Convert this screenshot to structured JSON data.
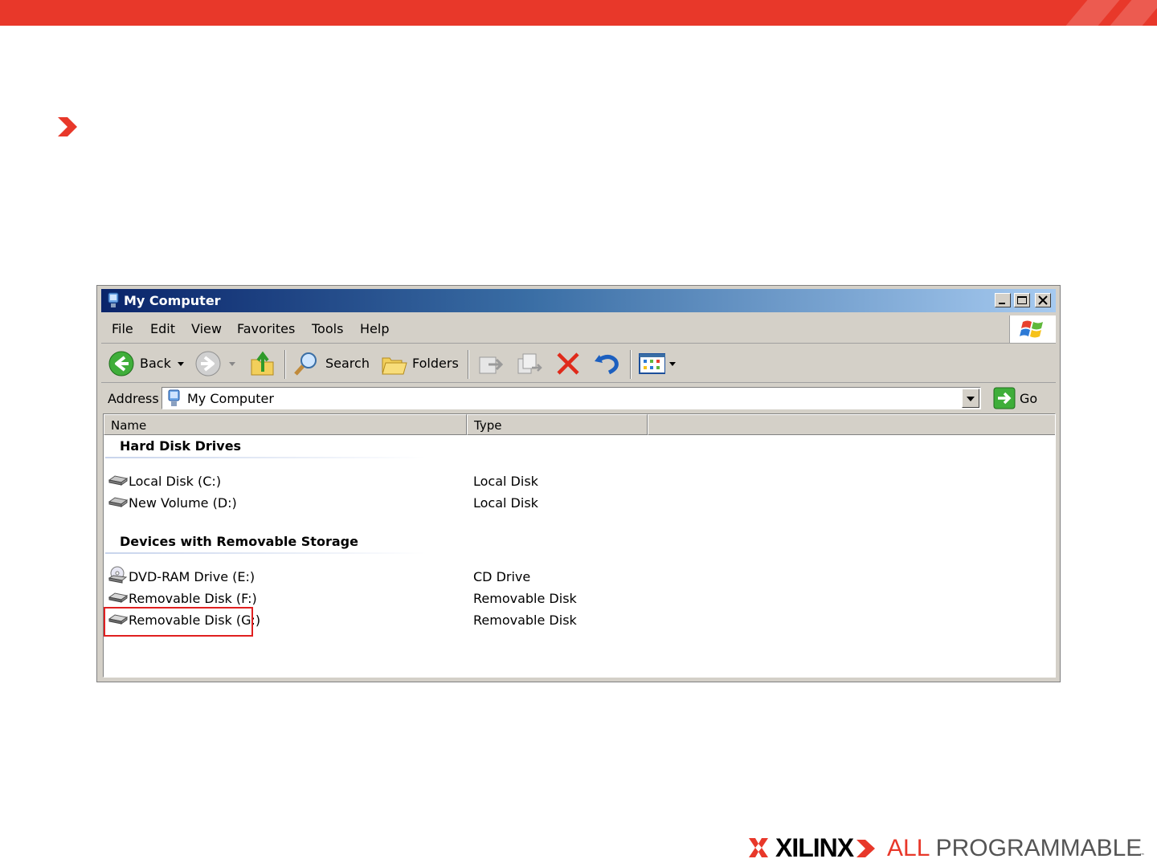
{
  "colors": {
    "brand_red": "#e8382a",
    "titlebar_start": "#0a246a",
    "titlebar_end": "#a6caf0",
    "highlight_box": "#e02020"
  },
  "window": {
    "title": "My Computer",
    "title_icon": "my-computer-icon",
    "controls": [
      "minimize-icon",
      "maximize-icon",
      "close-icon"
    ]
  },
  "menu": [
    "File",
    "Edit",
    "View",
    "Favorites",
    "Tools",
    "Help"
  ],
  "toolbar": {
    "back_label": "Back",
    "search_label": "Search",
    "folders_label": "Folders",
    "icons": [
      "back-icon",
      "forward-icon",
      "up-folder-icon",
      "search-icon",
      "folders-icon",
      "move-to-icon",
      "copy-to-icon",
      "delete-icon",
      "undo-icon",
      "views-icon"
    ]
  },
  "address": {
    "label": "Address",
    "value": "My Computer",
    "go_label": "Go"
  },
  "columns": {
    "name": "Name",
    "type": "Type"
  },
  "groups": [
    {
      "title": "Hard Disk Drives",
      "items": [
        {
          "name": "Local Disk (C:)",
          "type": "Local Disk",
          "icon": "hard-disk-icon"
        },
        {
          "name": "New Volume (D:)",
          "type": "Local Disk",
          "icon": "hard-disk-icon"
        }
      ]
    },
    {
      "title": "Devices with Removable Storage",
      "items": [
        {
          "name": "DVD-RAM Drive (E:)",
          "type": "CD Drive",
          "icon": "dvd-drive-icon"
        },
        {
          "name": "Removable Disk (F:)",
          "type": "Removable Disk",
          "icon": "removable-disk-icon"
        },
        {
          "name": "Removable Disk (G:)",
          "type": "Removable Disk",
          "icon": "removable-disk-icon",
          "highlighted": true
        }
      ]
    }
  ],
  "footer": {
    "brand": "XILINX",
    "tagline_part1": "ALL",
    "tagline_part2": " PROGRAMMABLE",
    "trademark": "™"
  }
}
